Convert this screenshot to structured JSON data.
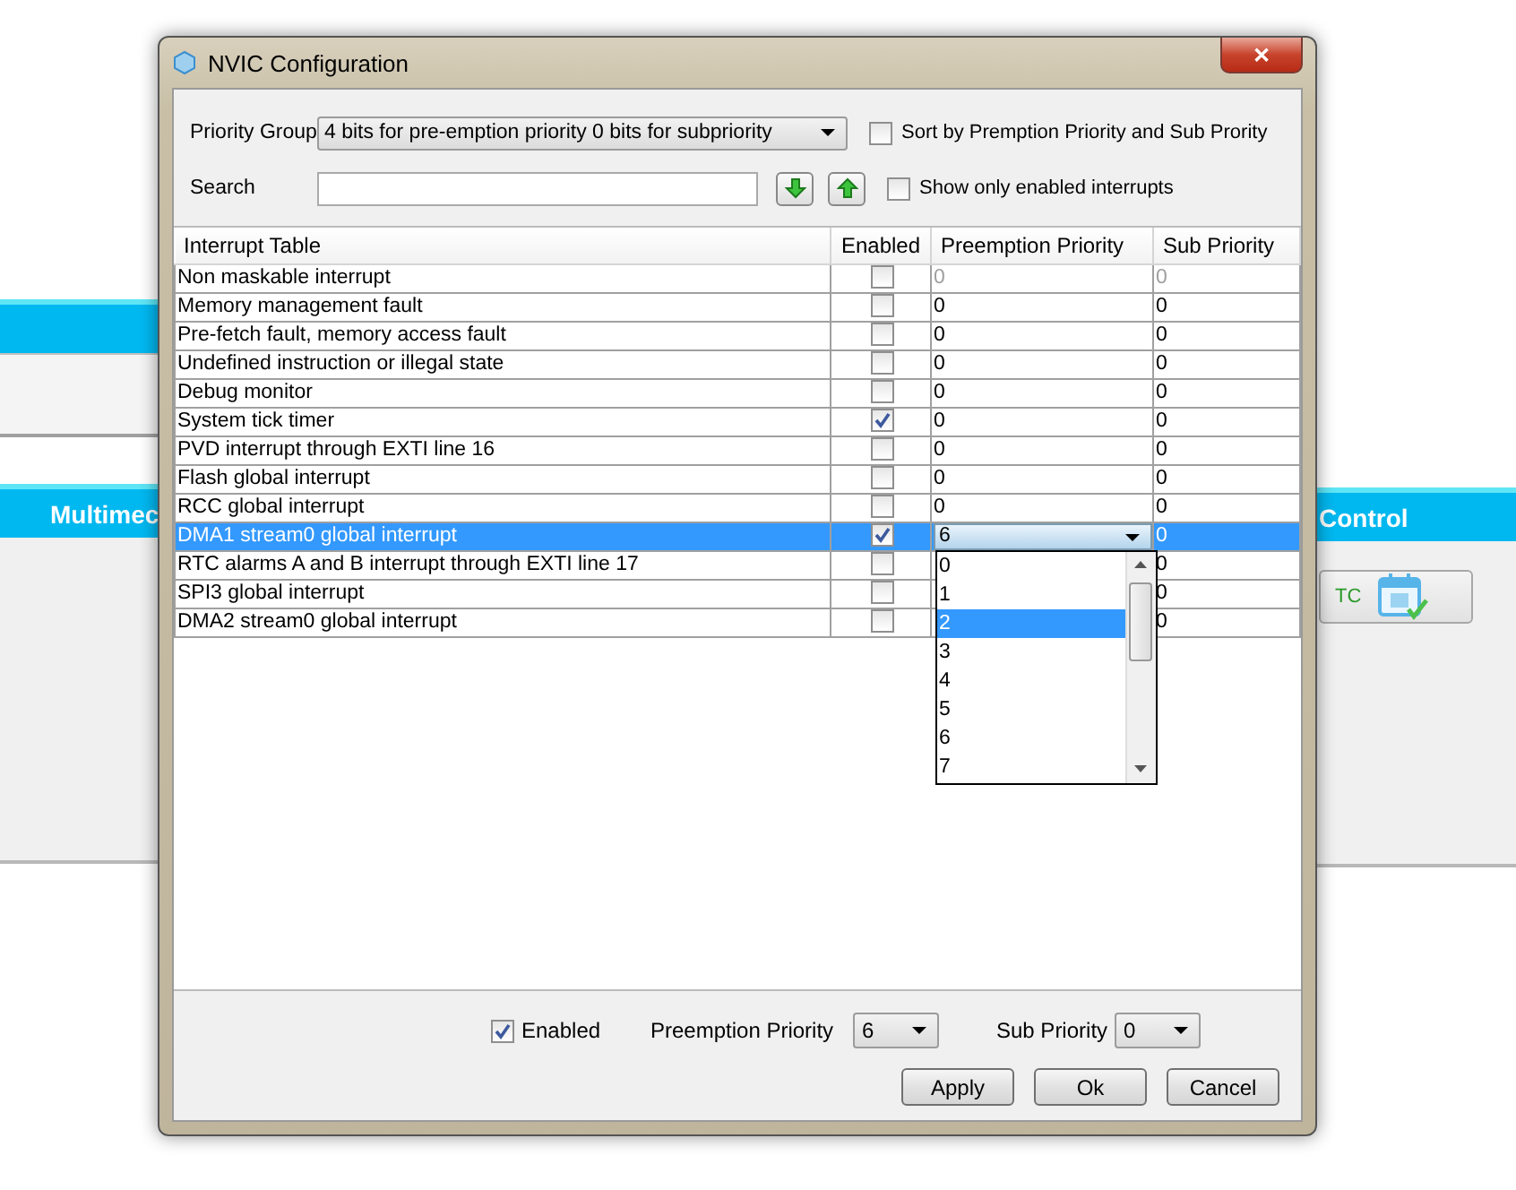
{
  "background_app": {
    "left_panel_title": "Multimec",
    "right_panel_title": "Control",
    "rtc_button": "TC"
  },
  "window": {
    "title": "NVIC Configuration",
    "close": "✕"
  },
  "priority_group": {
    "label": "Priority Group",
    "value": "4 bits for pre-emption priority 0 bits for subpriority"
  },
  "sort_option": {
    "label": "Sort by Premption Priority and Sub Prority",
    "checked": false
  },
  "search": {
    "label": "Search"
  },
  "show_enabled_option": {
    "label": "Show only enabled interrupts",
    "checked": false
  },
  "table": {
    "columns": [
      "Interrupt Table",
      "Enabled",
      "Preemption Priority",
      "Sub Priority"
    ],
    "rows": [
      {
        "name": "Non maskable interrupt",
        "enabled": false,
        "preemption": "0",
        "sub": "0",
        "disabled": true,
        "selected": false
      },
      {
        "name": "Memory management fault",
        "enabled": false,
        "preemption": "0",
        "sub": "0",
        "disabled": false,
        "selected": false
      },
      {
        "name": "Pre-fetch fault, memory access fault",
        "enabled": false,
        "preemption": "0",
        "sub": "0",
        "disabled": false,
        "selected": false
      },
      {
        "name": "Undefined instruction or illegal state",
        "enabled": false,
        "preemption": "0",
        "sub": "0",
        "disabled": false,
        "selected": false
      },
      {
        "name": "Debug monitor",
        "enabled": false,
        "preemption": "0",
        "sub": "0",
        "disabled": false,
        "selected": false
      },
      {
        "name": "System tick timer",
        "enabled": true,
        "preemption": "0",
        "sub": "0",
        "disabled": false,
        "selected": false
      },
      {
        "name": "PVD interrupt through EXTI line 16",
        "enabled": false,
        "preemption": "0",
        "sub": "0",
        "disabled": false,
        "selected": false
      },
      {
        "name": "Flash global interrupt",
        "enabled": false,
        "preemption": "0",
        "sub": "0",
        "disabled": false,
        "selected": false
      },
      {
        "name": "RCC global interrupt",
        "enabled": false,
        "preemption": "0",
        "sub": "0",
        "disabled": false,
        "selected": false
      },
      {
        "name": "DMA1 stream0 global interrupt",
        "enabled": true,
        "preemption": "6",
        "sub": "0",
        "disabled": false,
        "selected": true
      },
      {
        "name": "RTC alarms A and B interrupt through EXTI line 17",
        "enabled": false,
        "sub": "0",
        "disabled": false,
        "selected": false
      },
      {
        "name": "SPI3 global interrupt",
        "enabled": false,
        "sub": "0",
        "disabled": false,
        "selected": false
      },
      {
        "name": "DMA2 stream0 global interrupt",
        "enabled": false,
        "sub": "0",
        "disabled": false,
        "selected": false
      }
    ]
  },
  "priority_dropdown": {
    "options": [
      {
        "label": "0",
        "selected": false
      },
      {
        "label": "1",
        "selected": false
      },
      {
        "label": "2",
        "selected": true
      },
      {
        "label": "3",
        "selected": false
      },
      {
        "label": "4",
        "selected": false
      },
      {
        "label": "5",
        "selected": false
      },
      {
        "label": "6",
        "selected": false
      },
      {
        "label": "7",
        "selected": false
      }
    ]
  },
  "details": {
    "enabled_label": "Enabled",
    "enabled": true,
    "preemption_label": "Preemption Priority",
    "preemption_value": "6",
    "sub_label": "Sub Priority",
    "sub_value": "0"
  },
  "buttons": [
    "Apply",
    "Ok",
    "Cancel"
  ]
}
